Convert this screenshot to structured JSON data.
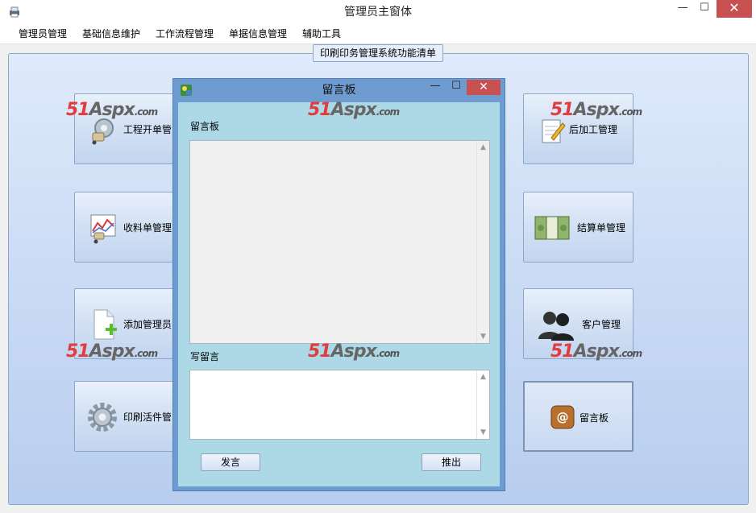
{
  "window": {
    "title": "管理员主窗体",
    "min_glyph": "—",
    "max_glyph": "☐",
    "close_glyph": "✕"
  },
  "menu": [
    "管理员管理",
    "基础信息维护",
    "工作流程管理",
    "单据信息管理",
    "辅助工具"
  ],
  "panel": {
    "group_label": "印刷印务管理系统功能清单"
  },
  "tiles": {
    "left": [
      "工程开单管",
      "收料单管理",
      "添加管理员",
      "印刷活件管"
    ],
    "right": [
      "后加工管理",
      "结算单管理",
      "客户管理",
      "留言板"
    ]
  },
  "watermark": {
    "brand": "51",
    "mid": "Aspx",
    "suffix": ".com"
  },
  "dialog": {
    "title": "留言板",
    "min_glyph": "—",
    "max_glyph": "☐",
    "close_glyph": "✕",
    "board_label": "留言板",
    "board_text": "",
    "write_label": "写留言",
    "write_text": "",
    "send_button": "发言",
    "exit_button": "推出"
  },
  "colors": {
    "close": "#c75050",
    "dialog_frame": "#6f9cd0",
    "dialog_body": "#add8e6",
    "watermark_red": "#e23b3b"
  }
}
